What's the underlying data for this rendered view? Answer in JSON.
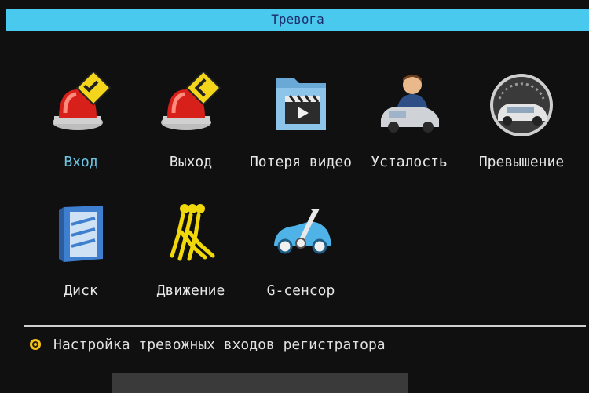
{
  "window": {
    "title": "Тревога"
  },
  "items": [
    {
      "label": "Вход",
      "icon": "alarm-input-icon",
      "selected": true
    },
    {
      "label": "Выход",
      "icon": "alarm-output-icon",
      "selected": false
    },
    {
      "label": "Потеря видео",
      "icon": "video-loss-icon",
      "selected": false
    },
    {
      "label": "Усталость",
      "icon": "fatigue-driver-icon",
      "selected": false
    },
    {
      "label": "Превышение",
      "icon": "speeding-icon",
      "selected": false
    },
    {
      "label": "Диск",
      "icon": "disk-icon",
      "selected": false
    },
    {
      "label": "Движение",
      "icon": "motion-icon",
      "selected": false
    },
    {
      "label": "G-сенсор",
      "icon": "g-sensor-icon",
      "selected": false
    }
  ],
  "status": {
    "text": "Настройка тревожных входов регистратора"
  },
  "colors": {
    "titlebar": "#49c9ee",
    "title_text": "#1b2a6b",
    "selected_label": "#6ec6e6",
    "bullet": "#f2c21a"
  }
}
